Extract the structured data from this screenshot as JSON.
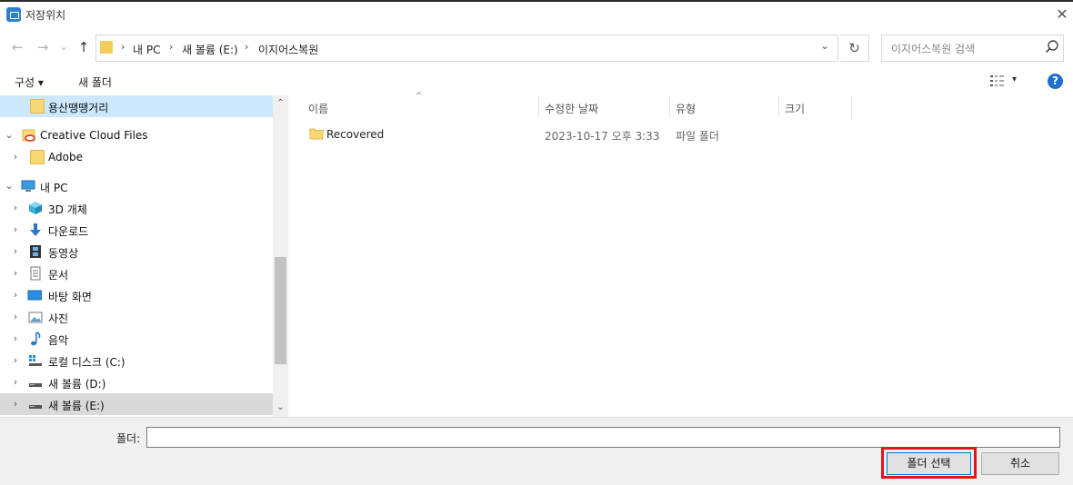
{
  "window": {
    "title": "저장위치",
    "close_glyph": "✕"
  },
  "nav": {
    "back": "←",
    "forward": "→",
    "recent": "⌄",
    "up": "↑"
  },
  "address": {
    "crumbs": [
      "내 PC",
      "새 볼륨 (E:)",
      "이지어스복원"
    ],
    "separator": "›",
    "dropdown": "⌄",
    "refresh": "↻"
  },
  "search": {
    "placeholder": "이지어스복원 검색"
  },
  "toolbar": {
    "organize": "구성 ▾",
    "new_folder": "새 폴더",
    "view_dd": "▾",
    "help": "?"
  },
  "tree": {
    "items": [
      {
        "label": "용산땡땡거리",
        "icon": "folder-icon",
        "chevron": ""
      },
      {
        "label": "Creative Cloud Files",
        "icon": "creative-cloud-icon",
        "chevron": "⌄"
      },
      {
        "label": "Adobe",
        "icon": "folder-icon",
        "chevron": "›"
      },
      {
        "label": "내 PC",
        "icon": "pc-icon",
        "chevron": "⌄"
      },
      {
        "label": "3D 개체",
        "icon": "cube-icon",
        "chevron": "›"
      },
      {
        "label": "다운로드",
        "icon": "download-icon",
        "chevron": "›"
      },
      {
        "label": "동영상",
        "icon": "video-icon",
        "chevron": "›"
      },
      {
        "label": "문서",
        "icon": "document-icon",
        "chevron": "›"
      },
      {
        "label": "바탕 화면",
        "icon": "desktop-icon",
        "chevron": "›"
      },
      {
        "label": "사진",
        "icon": "picture-icon",
        "chevron": "›"
      },
      {
        "label": "음악",
        "icon": "music-icon",
        "chevron": "›"
      },
      {
        "label": "로컬 디스크 (C:)",
        "icon": "drive-icon",
        "chevron": "›"
      },
      {
        "label": "새 볼륨 (D:)",
        "icon": "drive-icon",
        "chevron": "›"
      },
      {
        "label": "새 볼륨 (E:)",
        "icon": "drive-icon",
        "chevron": "›"
      }
    ],
    "scroll_up": "⌃",
    "scroll_down": "⌄"
  },
  "list": {
    "columns": [
      "이름",
      "수정한 날짜",
      "유형",
      "크기"
    ],
    "sort_caret": "^",
    "rows": [
      {
        "name": "Recovered",
        "modified": "2023-10-17 오후 3:33",
        "type": "파일 폴더",
        "size": ""
      }
    ]
  },
  "footer": {
    "folder_label": "폴더:",
    "folder_value": "",
    "select_button": "폴더 선택",
    "cancel_button": "취소"
  },
  "colors": {
    "accent": "#0078d7",
    "highlight_frame": "#e8121a",
    "selection": "#cce8ff"
  }
}
